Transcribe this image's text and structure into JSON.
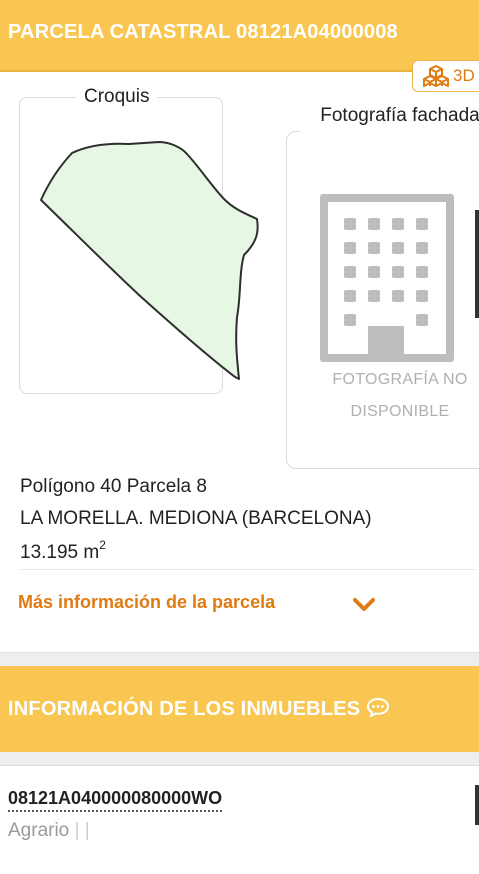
{
  "header": {
    "title": "PARCELA CATASTRAL 08121A04000008"
  },
  "toolbar": {
    "btn_3d_label": "3D",
    "btn_3d_icon": "boxes-3d-icon"
  },
  "croquis": {
    "legend": "Croquis",
    "fill_color": "#e6f7e4",
    "stroke_color": "#2e2e2e"
  },
  "photo": {
    "title": "Fotografía fachada",
    "placeholder_icon": "building-icon",
    "unavailable_line1": "FOTOGRAFÍA NO",
    "unavailable_line2": "DISPONIBLE"
  },
  "parcel": {
    "polygon_parcel": "Polígono 40 Parcela 8",
    "location": "LA MORELLA. MEDIONA (BARCELONA)",
    "area_value": "13.195 m",
    "area_unit_sup": "2"
  },
  "more_info": {
    "label": "Más información de la parcela",
    "icon": "chevron-down-icon"
  },
  "section": {
    "title": "INFORMACIÓN DE LOS INMUEBLES",
    "icon": "chat-bubble-icon"
  },
  "property": {
    "reference": "08121A040000080000WO",
    "use": "Agrario",
    "separators": "| |"
  },
  "colors": {
    "accent": "#f9c751",
    "link": "#e07b12",
    "muted": "#b0b0b0"
  }
}
